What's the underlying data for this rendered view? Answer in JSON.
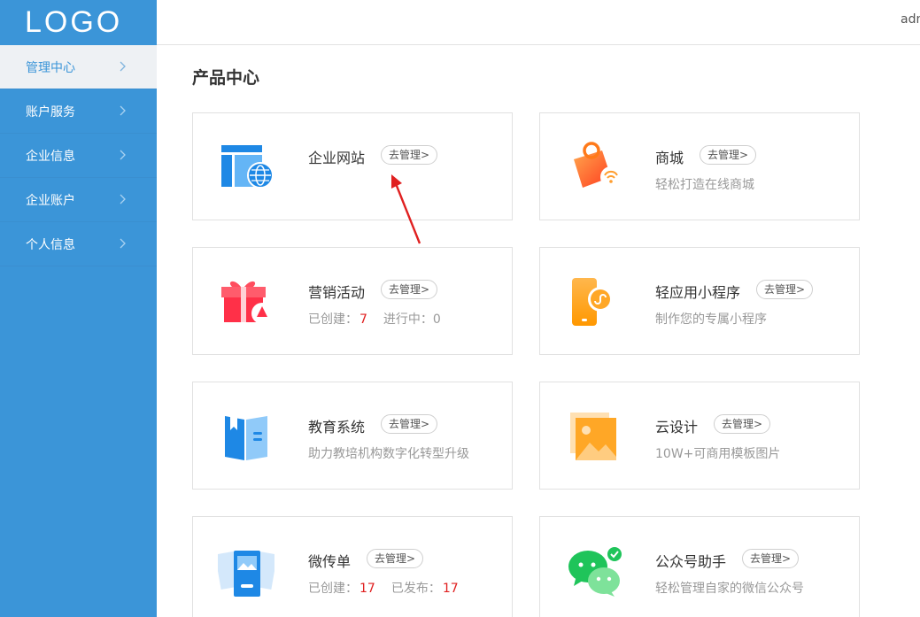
{
  "sidebar": {
    "logo": "LOGO",
    "items": [
      {
        "label": "管理中心",
        "active": true
      },
      {
        "label": "账户服务"
      },
      {
        "label": "企业信息"
      },
      {
        "label": "企业账户"
      },
      {
        "label": "个人信息"
      }
    ]
  },
  "topbar": {
    "user": "admin"
  },
  "main": {
    "title": "产品中心",
    "manage_label": "去管理>",
    "cards": [
      {
        "name": "企业网站",
        "icon": "website-icon"
      },
      {
        "name": "商城",
        "desc": "轻松打造在线商城",
        "icon": "shop-bag-icon"
      },
      {
        "name": "营销活动",
        "stat1_label": "已创建：",
        "stat1_value": "7",
        "stat2_label": "进行中：",
        "stat2_value": "0",
        "icon": "gift-icon"
      },
      {
        "name": "轻应用小程序",
        "desc": "制作您的专属小程序",
        "icon": "mini-program-icon"
      },
      {
        "name": "教育系统",
        "desc": "助力教培机构数字化转型升级",
        "icon": "book-icon"
      },
      {
        "name": "云设计",
        "desc": "10W+可商用模板图片",
        "icon": "image-design-icon"
      },
      {
        "name": "微传单",
        "stat1_label": "已创建：",
        "stat1_value": "17",
        "stat2_label": "已发布：",
        "stat2_value": "17",
        "icon": "flyer-icon"
      },
      {
        "name": "公众号助手",
        "desc": "轻松管理自家的微信公众号",
        "icon": "wechat-icon"
      }
    ]
  },
  "colors": {
    "sidebar": "#3b95d8",
    "active_bg": "#eef1f4",
    "stat_value": "#e02020",
    "annotation_arrow": "#e02020"
  }
}
